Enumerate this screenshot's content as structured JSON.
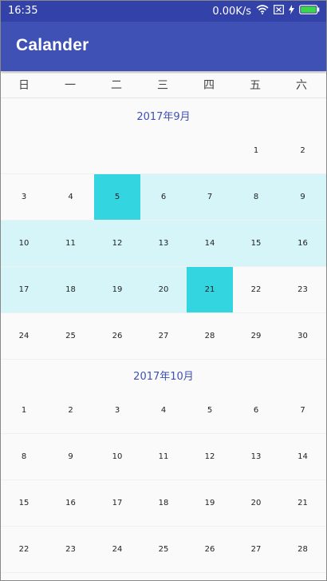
{
  "status_bar": {
    "time": "16:35",
    "speed": "0.00K/s"
  },
  "app": {
    "title": "Calander"
  },
  "weekdays": [
    "日",
    "一",
    "二",
    "三",
    "四",
    "五",
    "六"
  ],
  "months": [
    {
      "title": "2017年9月",
      "weeks": [
        [
          null,
          null,
          null,
          null,
          null,
          "1",
          "2"
        ],
        [
          "3",
          "4",
          "5",
          "6",
          "7",
          "8",
          "9"
        ],
        [
          "10",
          "11",
          "12",
          "13",
          "14",
          "15",
          "16"
        ],
        [
          "17",
          "18",
          "19",
          "20",
          "21",
          "22",
          "23"
        ],
        [
          "24",
          "25",
          "26",
          "27",
          "28",
          "29",
          "30"
        ]
      ]
    },
    {
      "title": "2017年10月",
      "weeks": [
        [
          "1",
          "2",
          "3",
          "4",
          "5",
          "6",
          "7"
        ],
        [
          "8",
          "9",
          "10",
          "11",
          "12",
          "13",
          "14"
        ],
        [
          "15",
          "16",
          "17",
          "18",
          "19",
          "20",
          "21"
        ],
        [
          "22",
          "23",
          "24",
          "25",
          "26",
          "27",
          "28"
        ]
      ]
    }
  ],
  "selection": {
    "start": "2017-09-05",
    "end": "2017-09-21"
  },
  "colors": {
    "app_bar": "#3f51b5",
    "status_bar": "#3342a8",
    "range": "#d6f5f8",
    "selected": "#33d5e1",
    "month_title": "#3f51b5"
  },
  "icons": [
    "wifi-icon",
    "sim-icon",
    "charging-icon",
    "battery-icon"
  ]
}
